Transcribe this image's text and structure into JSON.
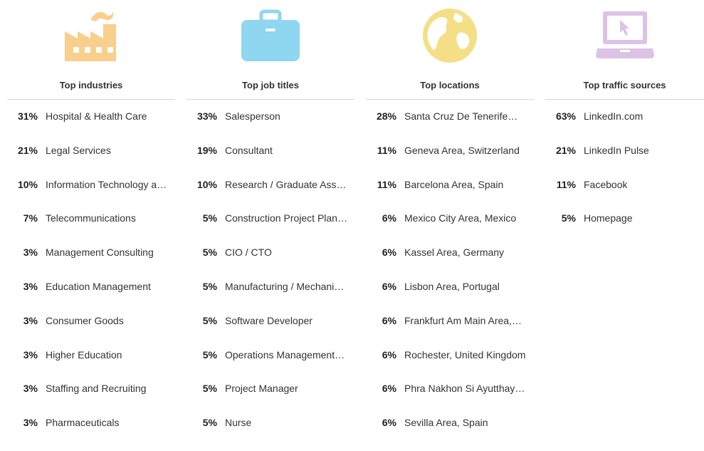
{
  "colors": {
    "factory_icon": "#f9cf8d",
    "briefcase_icon": "#8fd6f1",
    "globe_icon": "#f4df86",
    "laptop_icon": "#dcc3e6"
  },
  "columns": [
    {
      "title": "Top industries",
      "icon": "factory-icon",
      "items": [
        {
          "pct": "31%",
          "label": "Hospital & Health Care"
        },
        {
          "pct": "21%",
          "label": "Legal Services"
        },
        {
          "pct": "10%",
          "label": "Information Technology a…"
        },
        {
          "pct": "7%",
          "label": "Telecommunications"
        },
        {
          "pct": "3%",
          "label": "Management Consulting"
        },
        {
          "pct": "3%",
          "label": "Education Management"
        },
        {
          "pct": "3%",
          "label": "Consumer Goods"
        },
        {
          "pct": "3%",
          "label": "Higher Education"
        },
        {
          "pct": "3%",
          "label": "Staffing and Recruiting"
        },
        {
          "pct": "3%",
          "label": "Pharmaceuticals"
        }
      ]
    },
    {
      "title": "Top job titles",
      "icon": "briefcase-icon",
      "items": [
        {
          "pct": "33%",
          "label": "Salesperson"
        },
        {
          "pct": "19%",
          "label": "Consultant"
        },
        {
          "pct": "10%",
          "label": "Research / Graduate Ass…"
        },
        {
          "pct": "5%",
          "label": "Construction Project Plan…"
        },
        {
          "pct": "5%",
          "label": "CIO / CTO"
        },
        {
          "pct": "5%",
          "label": "Manufacturing / Mechani…"
        },
        {
          "pct": "5%",
          "label": "Software Developer"
        },
        {
          "pct": "5%",
          "label": "Operations Management…"
        },
        {
          "pct": "5%",
          "label": "Project Manager"
        },
        {
          "pct": "5%",
          "label": "Nurse"
        }
      ]
    },
    {
      "title": "Top locations",
      "icon": "globe-icon",
      "items": [
        {
          "pct": "28%",
          "label": "Santa Cruz De Tenerife…"
        },
        {
          "pct": "11%",
          "label": "Geneva Area, Switzerland"
        },
        {
          "pct": "11%",
          "label": "Barcelona Area, Spain"
        },
        {
          "pct": "6%",
          "label": "Mexico City Area, Mexico"
        },
        {
          "pct": "6%",
          "label": "Kassel Area, Germany"
        },
        {
          "pct": "6%",
          "label": "Lisbon Area, Portugal"
        },
        {
          "pct": "6%",
          "label": "Frankfurt Am Main Area,…"
        },
        {
          "pct": "6%",
          "label": "Rochester, United Kingdom"
        },
        {
          "pct": "6%",
          "label": "Phra Nakhon Si Ayutthay…"
        },
        {
          "pct": "6%",
          "label": "Sevilla Area, Spain"
        }
      ]
    },
    {
      "title": "Top traffic sources",
      "icon": "laptop-icon",
      "items": [
        {
          "pct": "63%",
          "label": "LinkedIn.com"
        },
        {
          "pct": "21%",
          "label": "LinkedIn Pulse"
        },
        {
          "pct": "11%",
          "label": "Facebook"
        },
        {
          "pct": "5%",
          "label": "Homepage"
        }
      ]
    }
  ]
}
